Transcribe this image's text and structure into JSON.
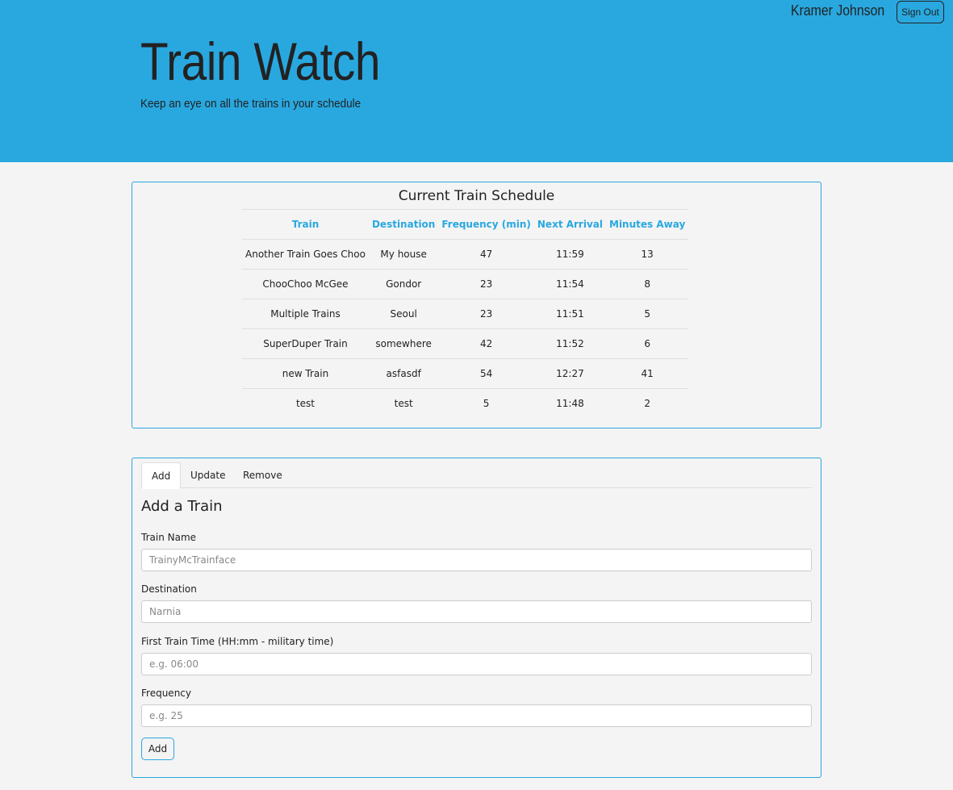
{
  "header": {
    "title": "Train Watch",
    "subtitle": "Keep an eye on all the trains in your schedule",
    "user_name": "Kramer Johnson",
    "sign_out_label": "Sign Out"
  },
  "schedule": {
    "title": "Current Train Schedule",
    "columns": [
      "Train",
      "Destination",
      "Frequency (min)",
      "Next Arrival",
      "Minutes Away"
    ],
    "rows": [
      [
        "Another Train Goes Choo",
        "My house",
        "47",
        "11:59",
        "13"
      ],
      [
        "ChooChoo McGee",
        "Gondor",
        "23",
        "11:54",
        "8"
      ],
      [
        "Multiple Trains",
        "Seoul",
        "23",
        "11:51",
        "5"
      ],
      [
        "SuperDuper Train",
        "somewhere",
        "42",
        "11:52",
        "6"
      ],
      [
        "new Train",
        "asfasdf",
        "54",
        "12:27",
        "41"
      ],
      [
        "test",
        "test",
        "5",
        "11:48",
        "2"
      ]
    ]
  },
  "form": {
    "tabs": [
      {
        "label": "Add",
        "active": true
      },
      {
        "label": "Update",
        "active": false
      },
      {
        "label": "Remove",
        "active": false
      }
    ],
    "title": "Add a Train",
    "fields": {
      "train_name": {
        "label": "Train Name",
        "placeholder": "TrainyMcTrainface",
        "value": ""
      },
      "destination": {
        "label": "Destination",
        "placeholder": "Narnia",
        "value": ""
      },
      "first_train_time": {
        "label": "First Train Time (HH:mm - military time)",
        "placeholder": "e.g. 06:00",
        "value": ""
      },
      "frequency": {
        "label": "Frequency",
        "placeholder": "e.g. 25",
        "value": ""
      }
    },
    "submit_label": "Add"
  },
  "colors": {
    "accent": "#29a8e0",
    "background": "#f4f4f4",
    "text": "#222222"
  }
}
